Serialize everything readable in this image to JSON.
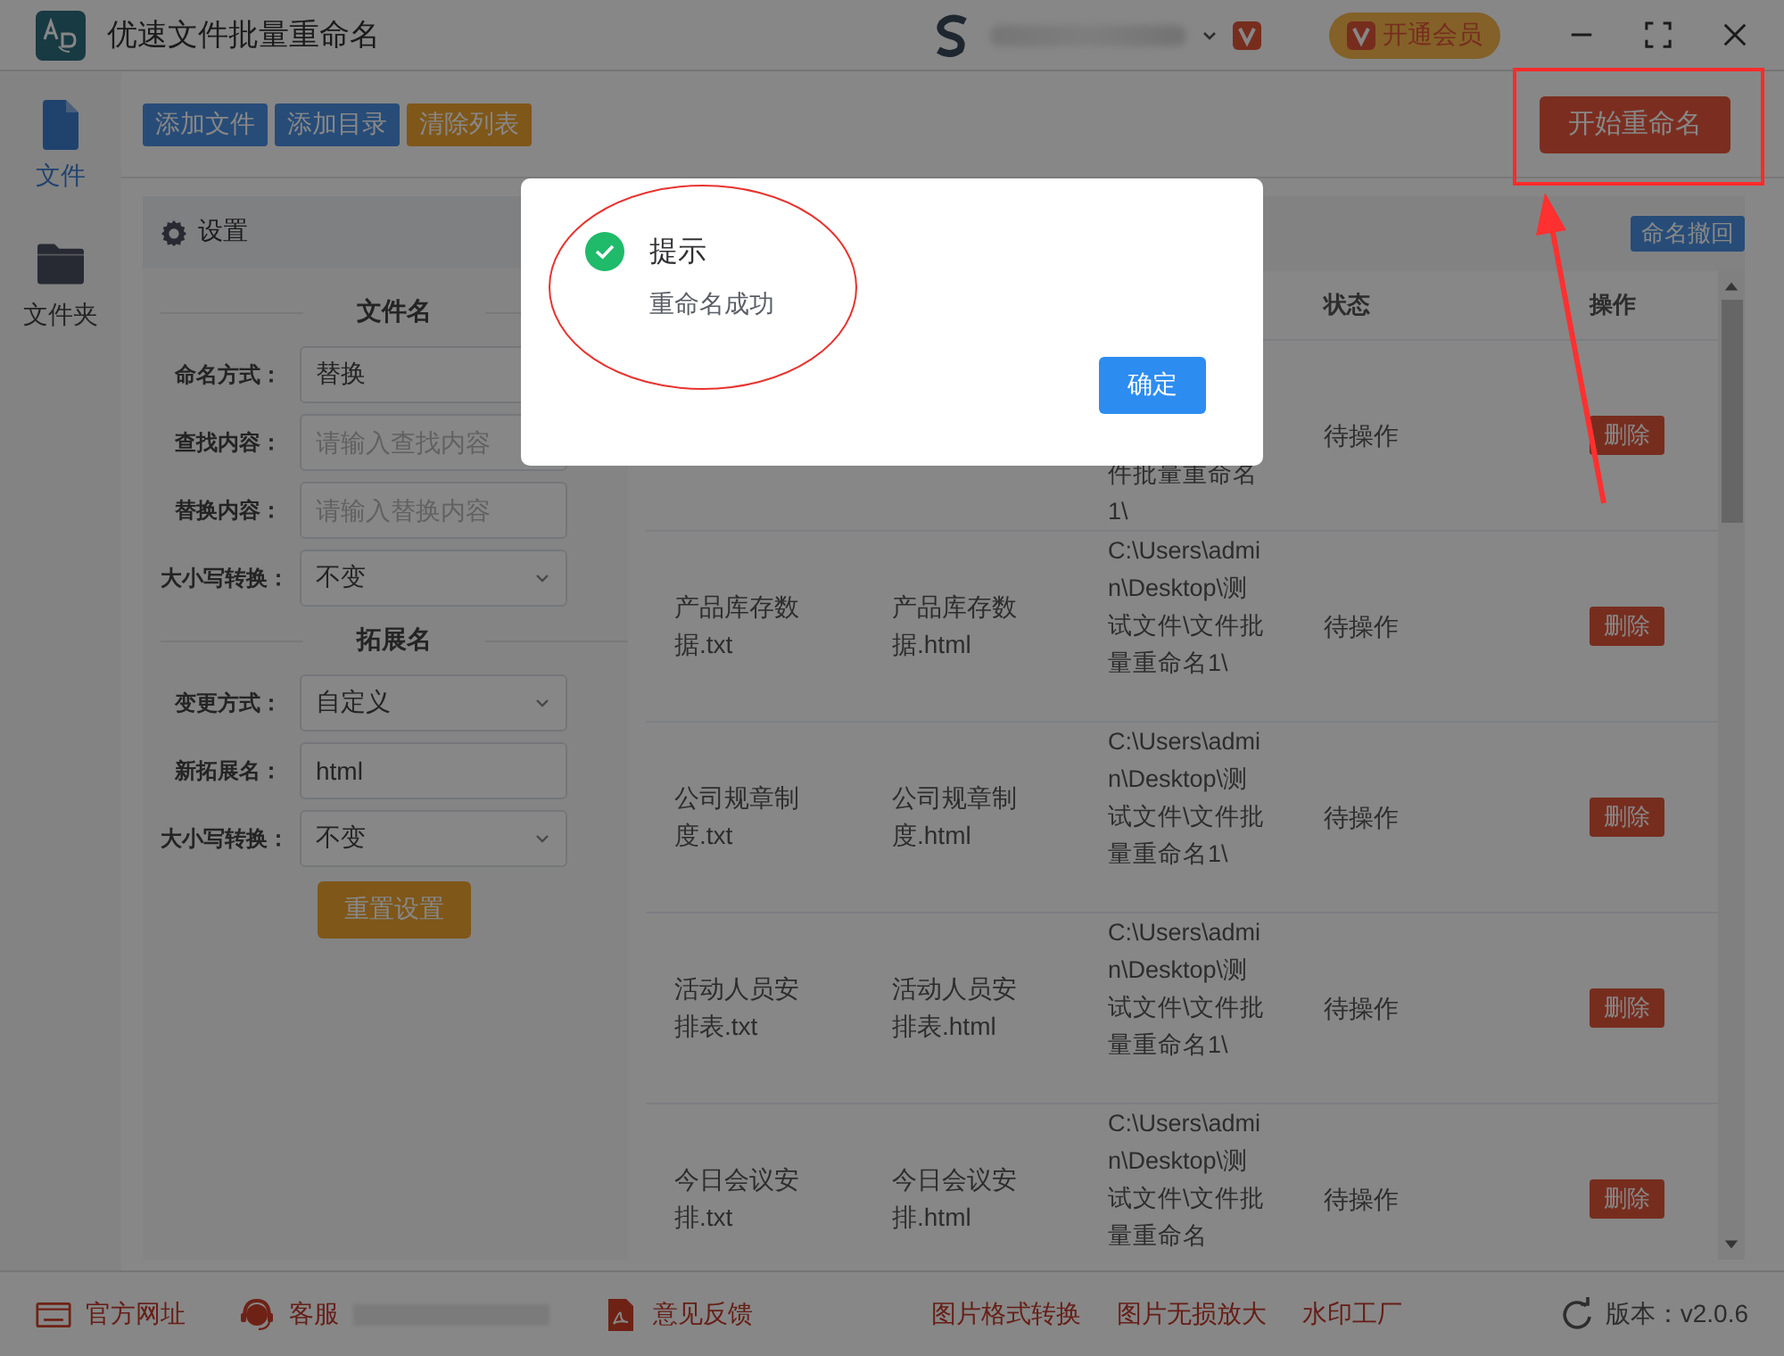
{
  "window": {
    "title": "优速文件批量重命名",
    "vip_button": "开通会员"
  },
  "toolbar": {
    "buttons": [
      {
        "label": "添加文件",
        "kind": "primary"
      },
      {
        "label": "添加目录",
        "kind": "primary"
      },
      {
        "label": "清除列表",
        "kind": "warning"
      }
    ],
    "start_button": "开始重命名"
  },
  "sidebar": {
    "items": [
      {
        "label": "文件",
        "selected": true
      },
      {
        "label": "文件夹",
        "selected": false
      }
    ]
  },
  "settings": {
    "title": "设置",
    "sections": [
      {
        "heading": "文件名",
        "fields": [
          {
            "label": "命名方式：",
            "kind": "input",
            "value": "替换"
          },
          {
            "label": "查找内容：",
            "kind": "input",
            "placeholder": "请输入查找内容"
          },
          {
            "label": "替换内容：",
            "kind": "input",
            "placeholder": "请输入替换内容"
          },
          {
            "label": "大小写转换：",
            "kind": "select",
            "value": "不变"
          }
        ]
      },
      {
        "heading": "拓展名",
        "fields": [
          {
            "label": "变更方式：",
            "kind": "select",
            "value": "自定义"
          },
          {
            "label": "新拓展名：",
            "kind": "input",
            "value": "html"
          },
          {
            "label": "大小写转换：",
            "kind": "select",
            "value": "不变"
          }
        ]
      }
    ],
    "reset_button": "重置设置"
  },
  "table": {
    "undo_button": "命名撤回",
    "columns": [
      "状态",
      "操作"
    ],
    "rows": [
      {
        "path": "件批量重命名1\\",
        "status": "待操作",
        "action": "删除",
        "cut_top": true
      },
      {
        "original": "产品库存数据.txt",
        "new": "产品库存数据.html",
        "path": "C:\\Users\\admin\\Desktop\\测试文件\\文件批量重命名1\\",
        "status": "待操作",
        "action": "删除"
      },
      {
        "original": "公司规章制度.txt",
        "new": "公司规章制度.html",
        "path": "C:\\Users\\admin\\Desktop\\测试文件\\文件批量重命名1\\",
        "status": "待操作",
        "action": "删除"
      },
      {
        "original": "活动人员安排表.txt",
        "new": "活动人员安排表.html",
        "path": "C:\\Users\\admin\\Desktop\\测试文件\\文件批量重命名1\\",
        "status": "待操作",
        "action": "删除"
      },
      {
        "original": "今日会议安排.txt",
        "new": "今日会议安排.html",
        "path": "C:\\Users\\admin\\Desktop\\测试文件\\文件批量重命名",
        "status": "待操作",
        "action": "删除"
      }
    ]
  },
  "footer": {
    "items": [
      {
        "label": "官方网址",
        "kind": "web"
      },
      {
        "label": "客服",
        "kind": "support"
      },
      {
        "label": "意见反馈",
        "kind": "feedback"
      }
    ],
    "links": [
      "图片格式转换",
      "图片无损放大",
      "水印工厂"
    ],
    "version": "版本：v2.0.6"
  },
  "dialog": {
    "title": "提示",
    "message": "重命名成功",
    "ok_button": "确定"
  }
}
